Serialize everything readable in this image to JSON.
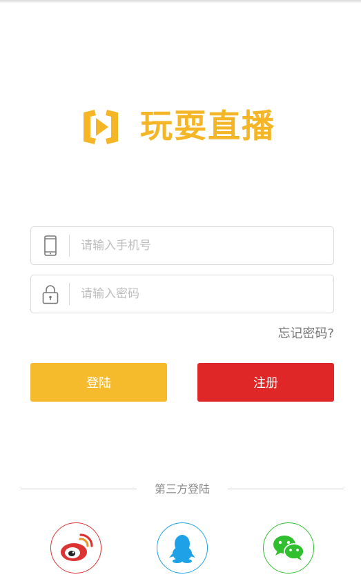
{
  "brand": {
    "name": "玩耍直播",
    "color": "#f4b627"
  },
  "login_form": {
    "phone_placeholder": "请输入手机号",
    "password_placeholder": "请输入密码",
    "forgot_password": "忘记密码?"
  },
  "buttons": {
    "login_label": "登陆",
    "login_color": "#f6bb2c",
    "register_label": "注册",
    "register_color": "#e02727"
  },
  "third_party": {
    "title": "第三方登陆",
    "providers": [
      {
        "id": "weibo",
        "icon": "weibo-icon",
        "color": "#dd3333"
      },
      {
        "id": "qq",
        "icon": "qq-icon",
        "color": "#1ea1e6"
      },
      {
        "id": "wechat",
        "icon": "wechat-icon",
        "color": "#2fbf2f"
      }
    ]
  }
}
